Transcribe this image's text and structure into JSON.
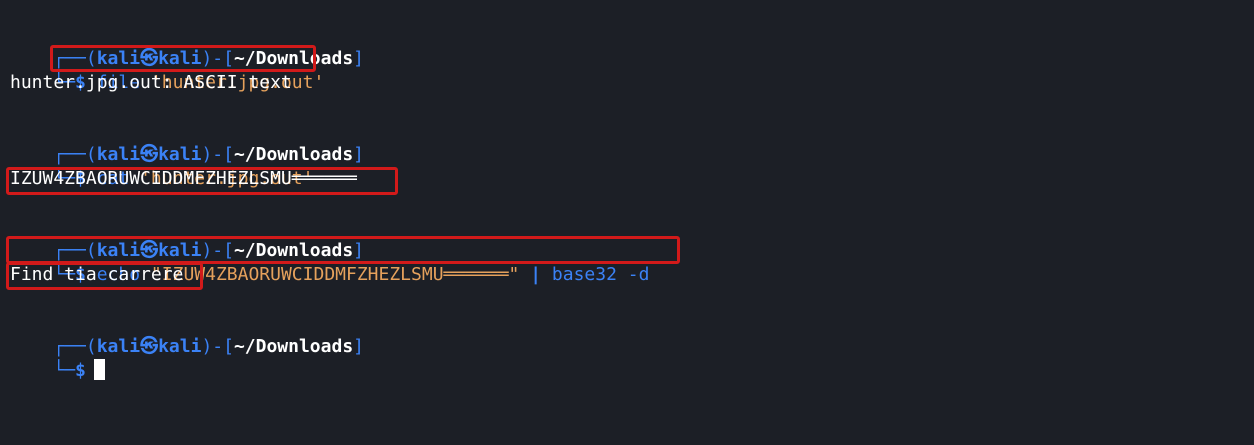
{
  "prompt": {
    "user": "kali",
    "separator": "㉿",
    "host": "kali",
    "path": "~/Downloads",
    "dollar": "$"
  },
  "blocks": [
    {
      "command": [
        {
          "text": "file",
          "style": "cmd"
        },
        {
          "text": " 'hunter.jpg.out'",
          "style": "str"
        }
      ],
      "output": "hunter.jpg.out: ASCII text"
    },
    {
      "command": [
        {
          "text": "cat",
          "style": "cmd"
        },
        {
          "text": " 'hunter.jpg.out'",
          "style": "str"
        }
      ],
      "output": "IZUW4ZBAORUWCIDDMFZHEZLSMU══════"
    },
    {
      "command": [
        {
          "text": "echo",
          "style": "cmd"
        },
        {
          "text": " \"IZUW4ZBAORUWCIDDMFZHEZLSMU══════\"",
          "style": "str"
        },
        {
          "text": " | ",
          "style": "pipe"
        },
        {
          "text": "base32",
          "style": "cmd"
        },
        {
          "text": " -d",
          "style": "cmd"
        }
      ],
      "output": "Find tia carrere"
    }
  ]
}
